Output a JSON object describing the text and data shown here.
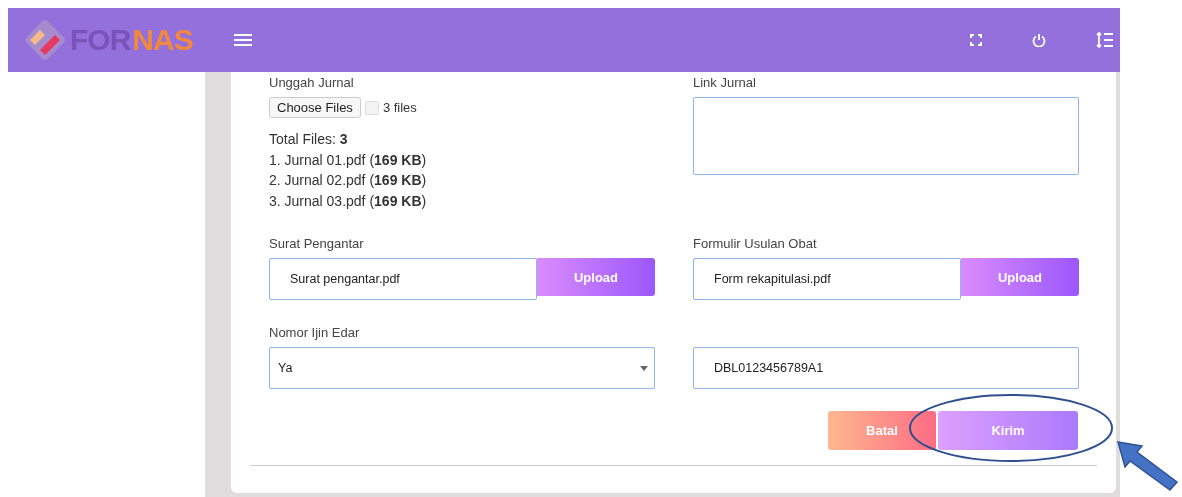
{
  "header": {
    "logo": {
      "part_1": "FOR",
      "part_2": "NAS"
    }
  },
  "form": {
    "journal_upload": {
      "label": "Unggah Jurnal",
      "button": "Choose Files",
      "status": "3 files",
      "total": "Total Files: **3**",
      "files": [
        "1. Jurnal 01.pdf (**169 KB**)",
        "2. Jurnal 02.pdf (**169 KB**)",
        "3. Jurnal 03.pdf (**169 KB**)"
      ]
    },
    "journal_link": {
      "label": "Link Jurnal"
    },
    "cover_letter": {
      "label": "Surat Pengantar",
      "value": "Surat pengantar.pdf",
      "button": "Upload"
    },
    "drug_form": {
      "label": "Formulir Usulan Obat",
      "value": "Form rekapitulasi.pdf",
      "button": "Upload"
    },
    "permit": {
      "label": "Nomor Ijin Edar",
      "select_value": "Ya",
      "number_value": "DBL0123456789A1"
    },
    "actions": [
      {
        "kind": "cancel",
        "label": "Batal"
      },
      {
        "kind": "submit",
        "label": "Kirim"
      }
    ]
  },
  "annotation": {
    "highlight": true
  }
}
